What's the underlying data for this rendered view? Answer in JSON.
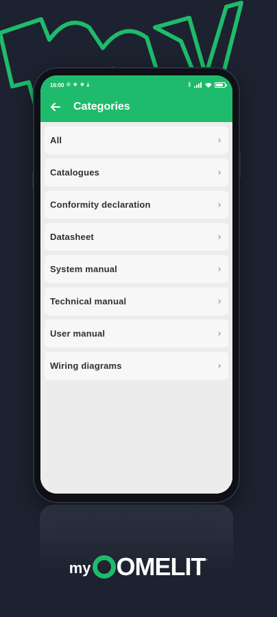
{
  "status_bar": {
    "time": "16:00",
    "left_icons": [
      "settings-icon",
      "dropbox-icon",
      "dropbox-icon",
      "download-icon"
    ],
    "right_icons": [
      "bluetooth-icon",
      "signal-icon",
      "wifi-icon",
      "battery-icon"
    ],
    "battery_level": 0.8
  },
  "header": {
    "title": "Categories",
    "back_icon": "arrow-left-icon"
  },
  "categories": [
    {
      "label": "All"
    },
    {
      "label": "Catalogues"
    },
    {
      "label": "Conformity declaration"
    },
    {
      "label": "Datasheet"
    },
    {
      "label": "System manual"
    },
    {
      "label": "Technical manual"
    },
    {
      "label": "User manual"
    },
    {
      "label": "Wiring diagrams"
    }
  ],
  "brand": {
    "my": "my",
    "name_rest": "OMELIT",
    "dot": ".",
    "accent_color": "#1fbb6c",
    "background_color": "#1d2230"
  }
}
